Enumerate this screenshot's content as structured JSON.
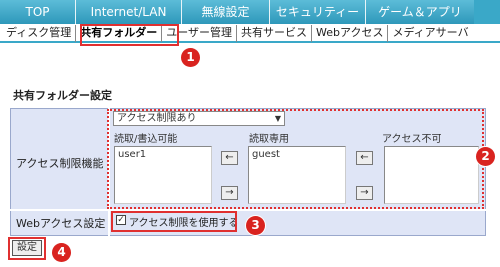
{
  "topnav": [
    "TOP",
    "Internet/LAN",
    "無線設定",
    "セキュリティー",
    "ゲーム＆アプリ"
  ],
  "subnav": [
    "ディスク管理",
    "共有フォルダー",
    "ユーザー管理",
    "共有サービス",
    "Webアクセス",
    "メディアサーバ"
  ],
  "page_title": "共有フォルダー設定",
  "access_label": "アクセス制限機能",
  "access_select": "アクセス制限あり",
  "columns": [
    "読取/書込可能",
    "読取専用",
    "アクセス不可"
  ],
  "lists": {
    "rw": "user1",
    "ro": "guest",
    "none": ""
  },
  "arrows": {
    "left": "←",
    "right": "→"
  },
  "web_label": "Webアクセス設定",
  "web_checkbox_label": "アクセス制限を使用する",
  "checkbox_mark": "✓",
  "submit": "設定",
  "badges": [
    "1",
    "2",
    "3",
    "4"
  ],
  "colors": {
    "accent": "#3aa8c8",
    "highlight": "#e03030",
    "badge": "#d9231f",
    "panel": "#dfe5f6"
  }
}
